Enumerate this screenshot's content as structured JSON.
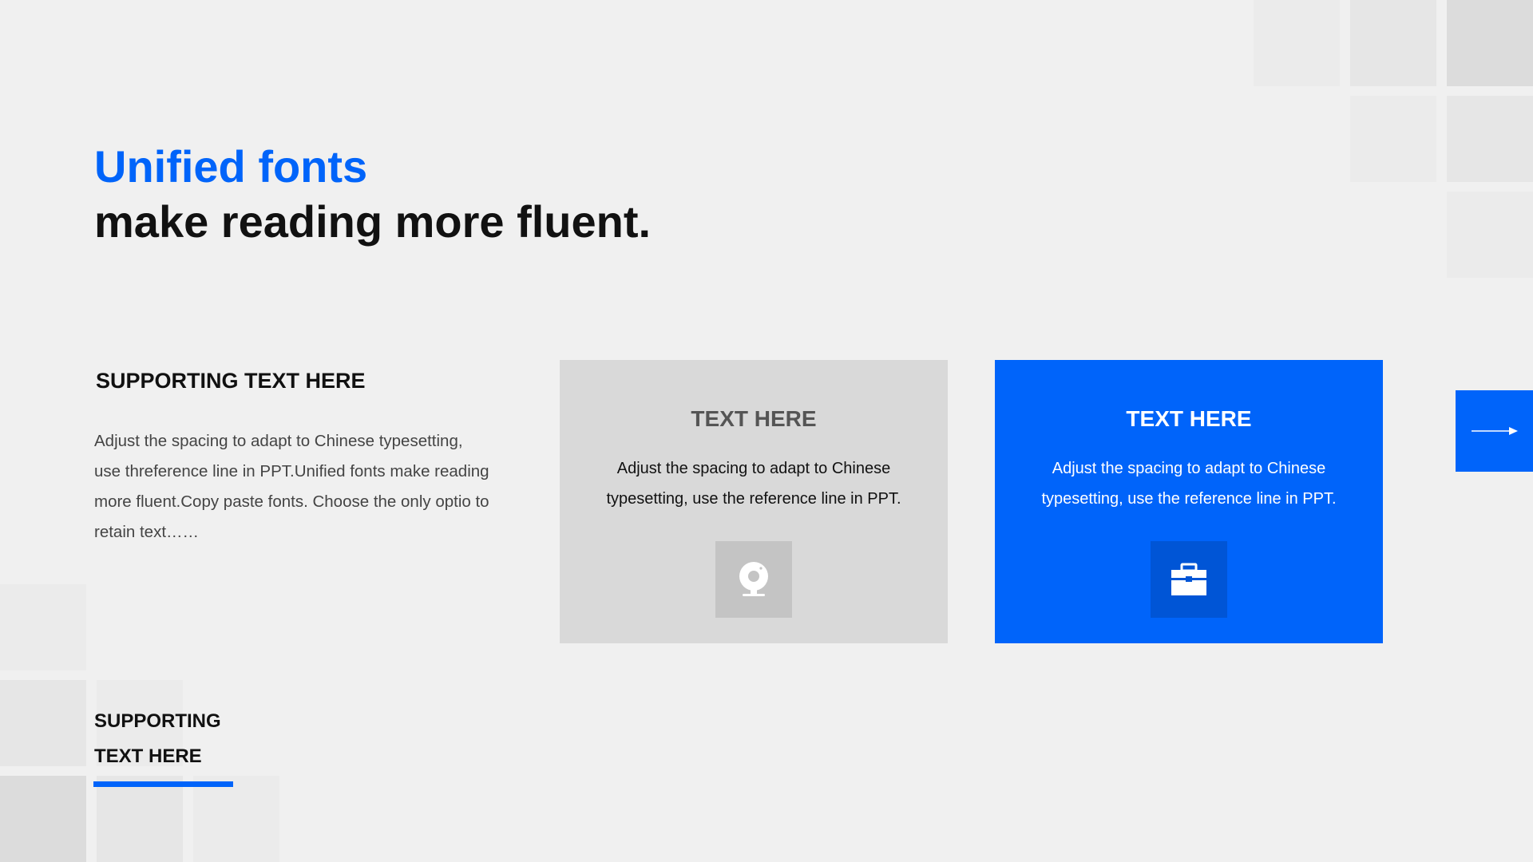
{
  "headline": {
    "line1": "Unified fonts",
    "line2": "make reading more fluent."
  },
  "intro": {
    "heading": "SUPPORTING TEXT HERE",
    "paragraph": "Adjust the spacing to adapt to Chinese typesetting, use threference line in PPT.Unified fonts make reading more fluent.Copy paste fonts. Choose the only optio to retain text……"
  },
  "cards": [
    {
      "title": "TEXT HERE",
      "text": "Adjust the spacing to adapt to Chinese typesetting, use the reference line in PPT.",
      "icon": "webcam-icon"
    },
    {
      "title": "TEXT HERE",
      "text": "Adjust the spacing to adapt to Chinese typesetting, use the reference line in PPT.",
      "icon": "toolbox-icon"
    }
  ],
  "footer": {
    "line1": "SUPPORTING",
    "line2": "TEXT HERE"
  },
  "nav": {
    "icon": "arrow-right-icon"
  },
  "colors": {
    "accent": "#0064fa",
    "background": "#f0f0f0",
    "card_gray": "#d9d9d9"
  }
}
